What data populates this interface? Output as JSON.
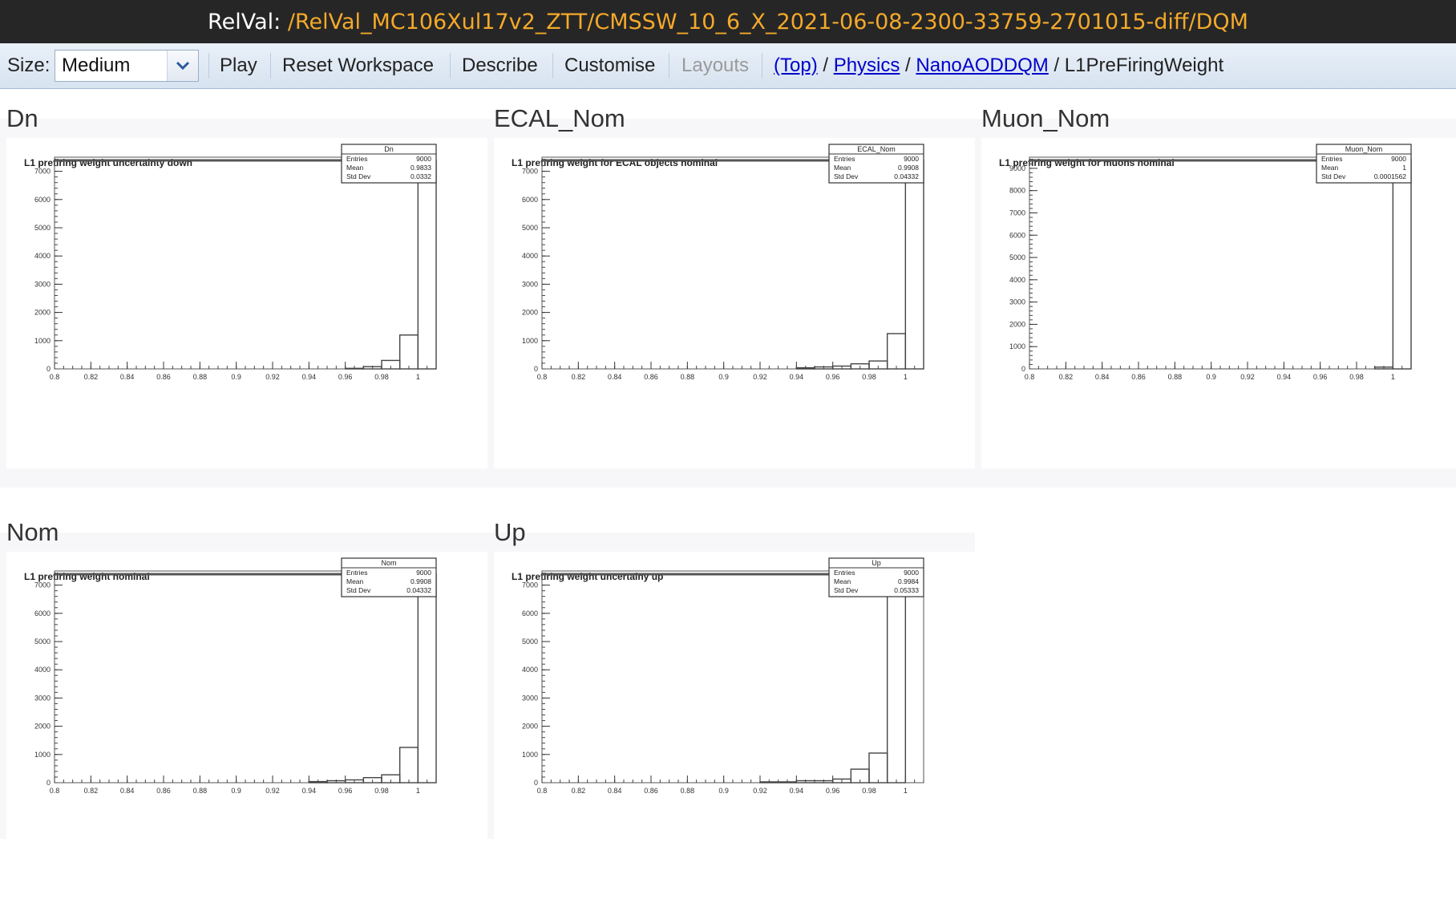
{
  "header": {
    "prefix": "RelVal: ",
    "path": "/RelVal_MC106Xul17v2_ZTT/CMSSW_10_6_X_2021-06-08-2300-33759-2701015-diff/DQM"
  },
  "toolbar": {
    "size_label": "Size:",
    "size_value": "Medium",
    "play": "Play",
    "reset": "Reset Workspace",
    "describe": "Describe",
    "customise": "Customise",
    "layouts": "Layouts",
    "breadcrumb": {
      "top": "(Top)",
      "sep": " / ",
      "physics": "Physics",
      "nano": "NanoAODDQM",
      "current": "L1PreFiringWeight"
    }
  },
  "colors": {
    "title_bar": "#262626",
    "path": "#f4a92a",
    "link": "#0000cc"
  },
  "x_ticks": [
    "0.8",
    "0.82",
    "0.84",
    "0.86",
    "0.88",
    "0.9",
    "0.92",
    "0.94",
    "0.96",
    "0.98",
    "1"
  ],
  "panels": [
    {
      "name": "Dn",
      "stat_name": "Dn"
    },
    {
      "name": "ECAL_Nom",
      "stat_name": "ECAL_Nom"
    },
    {
      "name": "Muon_Nom",
      "stat_name": "Muon_Nom"
    },
    {
      "name": "Nom",
      "stat_name": "Nom"
    },
    {
      "name": "Up",
      "stat_name": "Up"
    }
  ],
  "chart_data": [
    {
      "type": "bar",
      "title": "L1 prefiring weight uncertainty down",
      "stats": {
        "Entries": "9000",
        "Mean": "0.9833",
        "Std Dev": "0.0332"
      },
      "xlim": [
        0.8,
        1.01
      ],
      "ylim": [
        0,
        7500
      ],
      "y_ticks": [
        "1000",
        "2000",
        "3000",
        "4000",
        "5000",
        "6000",
        "7000"
      ],
      "bins": [
        {
          "x0": 0.8,
          "x1": 0.96,
          "y": 0
        },
        {
          "x0": 0.96,
          "x1": 0.97,
          "y": 20
        },
        {
          "x0": 0.97,
          "x1": 0.98,
          "y": 80
        },
        {
          "x0": 0.98,
          "x1": 0.99,
          "y": 300
        },
        {
          "x0": 0.99,
          "x1": 1.0,
          "y": 1200
        },
        {
          "x0": 1.0,
          "x1": 1.01,
          "y": 7400
        }
      ]
    },
    {
      "type": "bar",
      "title": "L1 prefiring weight for ECAL objects nominal",
      "stats": {
        "Entries": "9000",
        "Mean": "0.9908",
        "Std Dev": "0.04332"
      },
      "xlim": [
        0.8,
        1.01
      ],
      "ylim": [
        0,
        7500
      ],
      "y_ticks": [
        "1000",
        "2000",
        "3000",
        "4000",
        "5000",
        "6000",
        "7000"
      ],
      "bins": [
        {
          "x0": 0.8,
          "x1": 0.94,
          "y": 0
        },
        {
          "x0": 0.94,
          "x1": 0.95,
          "y": 40
        },
        {
          "x0": 0.95,
          "x1": 0.96,
          "y": 70
        },
        {
          "x0": 0.96,
          "x1": 0.97,
          "y": 100
        },
        {
          "x0": 0.97,
          "x1": 0.98,
          "y": 180
        },
        {
          "x0": 0.98,
          "x1": 0.99,
          "y": 280
        },
        {
          "x0": 0.99,
          "x1": 1.0,
          "y": 1250
        },
        {
          "x0": 1.0,
          "x1": 1.01,
          "y": 7400
        }
      ]
    },
    {
      "type": "bar",
      "title": "L1 prefiring weight for muons nominal",
      "stats": {
        "Entries": "9000",
        "Mean": "1",
        "Std Dev": "0.0001562"
      },
      "xlim": [
        0.8,
        1.01
      ],
      "ylim": [
        0,
        9500
      ],
      "y_ticks": [
        "1000",
        "2000",
        "3000",
        "4000",
        "5000",
        "6000",
        "7000",
        "8000",
        "9000"
      ],
      "bins": [
        {
          "x0": 0.8,
          "x1": 0.99,
          "y": 0
        },
        {
          "x0": 0.99,
          "x1": 1.0,
          "y": 80
        },
        {
          "x0": 1.0,
          "x1": 1.01,
          "y": 9400
        }
      ]
    },
    {
      "type": "bar",
      "title": "L1 prefiring weight nominal",
      "stats": {
        "Entries": "9000",
        "Mean": "0.9908",
        "Std Dev": "0.04332"
      },
      "xlim": [
        0.8,
        1.01
      ],
      "ylim": [
        0,
        7500
      ],
      "y_ticks": [
        "1000",
        "2000",
        "3000",
        "4000",
        "5000",
        "6000",
        "7000"
      ],
      "bins": [
        {
          "x0": 0.8,
          "x1": 0.94,
          "y": 0
        },
        {
          "x0": 0.94,
          "x1": 0.95,
          "y": 40
        },
        {
          "x0": 0.95,
          "x1": 0.96,
          "y": 70
        },
        {
          "x0": 0.96,
          "x1": 0.97,
          "y": 100
        },
        {
          "x0": 0.97,
          "x1": 0.98,
          "y": 180
        },
        {
          "x0": 0.98,
          "x1": 0.99,
          "y": 280
        },
        {
          "x0": 0.99,
          "x1": 1.0,
          "y": 1250
        },
        {
          "x0": 1.0,
          "x1": 1.01,
          "y": 7400
        }
      ]
    },
    {
      "type": "bar",
      "title": "L1 prefiring weight uncertainy up",
      "stats": {
        "Entries": "9000",
        "Mean": "0.9984",
        "Std Dev": "0.05333"
      },
      "xlim": [
        0.8,
        1.01
      ],
      "ylim": [
        0,
        7500
      ],
      "y_ticks": [
        "1000",
        "2000",
        "3000",
        "4000",
        "5000",
        "6000",
        "7000"
      ],
      "bins": [
        {
          "x0": 0.8,
          "x1": 0.92,
          "y": 0
        },
        {
          "x0": 0.92,
          "x1": 0.94,
          "y": 30
        },
        {
          "x0": 0.94,
          "x1": 0.96,
          "y": 70
        },
        {
          "x0": 0.96,
          "x1": 0.97,
          "y": 130
        },
        {
          "x0": 0.97,
          "x1": 0.98,
          "y": 480
        },
        {
          "x0": 0.98,
          "x1": 0.99,
          "y": 1050
        },
        {
          "x0": 0.99,
          "x1": 1.0,
          "y": 7400
        },
        {
          "x0": 1.0,
          "x1": 1.01,
          "y": 0
        }
      ]
    }
  ]
}
